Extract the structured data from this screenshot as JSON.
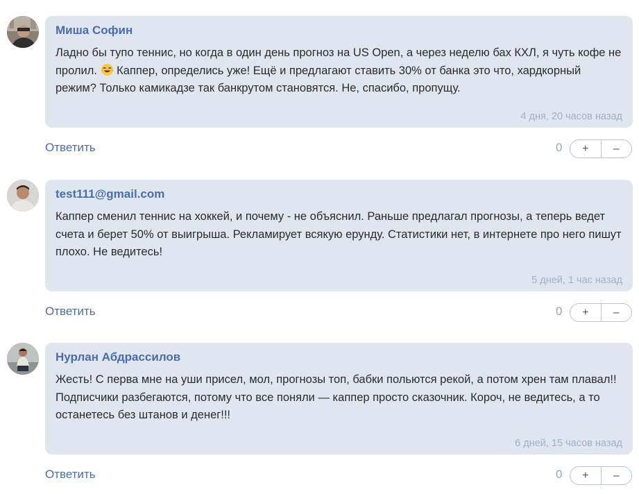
{
  "comments": [
    {
      "author": "Миша Софин",
      "text_before_emoji": "Ладно бы тупо теннис, но когда в один день прогноз на US Open, а через неделю бах КХЛ, я чуть кофе не пролил. ",
      "emoji": "face-with-tears-of-joy-icon",
      "text_after_emoji": " Каппер, определись уже! Ещё и предлагают ставить 30% от банка это что, хардкорный режим? Только камикадзе так банкрутом становятся. Не, спасибо, пропущу.",
      "time": "4 дня, 20 часов назад",
      "reply_label": "Ответить",
      "score": "0",
      "upvote_label": "+",
      "downvote_label": "–"
    },
    {
      "author": "test111@gmail.com",
      "text": "Каппер сменил теннис на хоккей, и почему - не объяснил. Раньше предлагал прогнозы, а теперь ведет счета и берет 50% от выигрыша. Рекламирует всякую ерунду. Статистики нет, в интернете про него пишут плохо. Не ведитесь!",
      "time": "5 дней, 1 час назад",
      "reply_label": "Ответить",
      "score": "0",
      "upvote_label": "+",
      "downvote_label": "–"
    },
    {
      "author": "Нурлан Абдрассилов",
      "text": "Жесть! С перва мне на уши присел, мол, прогнозы топ, бабки польются рекой, а потом хрен там плавал!! Подписчики разбегаются, потому что все поняли — каппер просто сказочник. Короч, не ведитесь, а то останетесь без штанов и денег!!!",
      "time": "6 дней, 15 часов назад",
      "reply_label": "Ответить",
      "score": "0",
      "upvote_label": "+",
      "downvote_label": "–"
    }
  ],
  "colors": {
    "bubble_bg": "#dfe6f0",
    "author": "#4a6da7",
    "time": "#9fb0cc",
    "link": "#4a6da7"
  }
}
